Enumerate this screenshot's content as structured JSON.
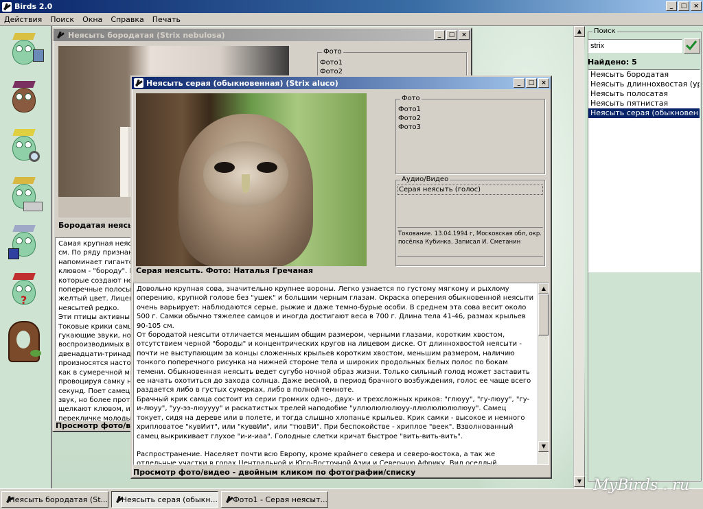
{
  "app": {
    "title": "Birds 2.0",
    "window_buttons": [
      "_",
      "□",
      "×"
    ]
  },
  "menu": [
    "Действия",
    "Поиск",
    "Окна",
    "Справка",
    "Печать"
  ],
  "sidebar_icons": [
    "owl-computer-icon",
    "owl-books-icon",
    "owl-magnifier-icon",
    "owl-printer-icon",
    "owl-diskette-icon",
    "owl-question-icon",
    "owl-tree-icon"
  ],
  "win_back": {
    "title": "Неясыть бородатая (Strix nebulosa)",
    "photo_caption": "Бородатая неясыть",
    "photos_label": "Фото",
    "photos": [
      "Фото1",
      "Фото2"
    ],
    "text_lines": [
      "Самая крупная неясыть",
      "см. По ряду признако",
      "напоминает гигантск",
      "клювом - \"бороду\". В",
      "которые создают не",
      "поперечные полосы.",
      "желтый цвет. Лицево",
      "неясытей редко.",
      "Эти птицы активны в",
      "Токовые крики самца",
      "гукающие звуки, но",
      "воспроизводимых в е",
      "двенадцати-тринадц",
      "произносятся настол",
      "как в сумеречной мгл",
      "провоцируя самку на",
      "секунд. Поет самец в",
      "звук, но более протя",
      "щелкают клювом, из",
      "перекличке молодые"
    ],
    "footer": "Просмотр фото/ви"
  },
  "win_front": {
    "title": "Неясыть серая (обыкновенная) (Strix aluco)",
    "photo_caption": "Серая неясыть. Фото: Наталья Гречаная",
    "photos_label": "Фото",
    "photos": [
      "Фото1",
      "Фото2",
      "Фото3"
    ],
    "av_label": "Аудио/Видео",
    "av_items": [
      "Серая неясыть (голос)"
    ],
    "av_note": "Токование. 13.04.1994 г, Московская обл, окр. посёлка Кубинка. Записал И. Сметанин",
    "text_paragraphs": [
      "Довольно крупная сова, значительно крупнее вороны. Легко узнается по густому мягкому и рыхлому оперению, крупной голове без \"ушек\" и большим черным глазам. Окраска оперения обыкновенной неясыти очень варьирует: наблюдаются серые, рыжие и даже темно-бурые особи. В среднем эта сова весит около 500 г. Самки обычно тяжелее самцов и иногда достигают веса в 700 г. Длина тела 41-46, размах крыльев 90-105 см.",
      "От бородатой неясыти отличается меньшим общим размером, черными глазами, коротким хвостом, отсутствием черной \"бороды\" и концентрических кругов на лицевом диске. От длиннохвостой неясыти - почти не выступающим за концы сложенных крыльев коротким хвостом, меньшим размером, наличию тонкого поперечного рисунка на нижней стороне тела и широких продольных белых полос по бокам темени. Обыкновенная неясыть ведет сугубо ночной образ жизни. Только сильный голод может заставить ее начать охотиться до захода солнца. Даже весной, в период брачного возбуждения, голос ее чаще всего раздается либо в густых сумерках, либо в полной темноте.",
      "Брачный крик самца состоит из серии громких одно-, двух- и трехсложных криков: \"глюуу\", \"гу-люуу\", \"гу-и-люуу\", \"уу-ээ-люуууу\" и раскатистых трелей наподобие \"уллюлюлюлюуу-ллюлюлюлюлюуу\". Самец токует, сидя на дереве или в полете, и тогда слышно хлопанье крыльев. Крик самки - высокое и немного хрипловатое \"кувИит\", или \"куввИи\", или \"тювВИ\". При беспокойстве - хриплое \"веек\". Взволнованный самец выкрикивает глухое \"и-и-иаа\". Голодные слетки кричат быстрое \"вить-вить-вить\".",
      "",
      "Распространение. Населяет почти всю Европу, кроме крайнего севера и северо-востока, а так же отдельные участки в горах Центральной и Юго-Восточной Азии и Северную Африку. Вид оседлый, кочующий зимой. Известны следующие подвиды:"
    ],
    "footer": "Просмотр фото/видео - двойным кликом по фотографии/списку"
  },
  "search": {
    "label": "Поиск",
    "value": "strix",
    "found": "Найдено: 5",
    "results": [
      "Неясыть бородатая",
      "Неясыть длиннохвостая (ур",
      "Неясыть полосатая",
      "Неясыть пятнистая",
      "Неясыть серая (обыкновен"
    ],
    "selected_index": 4
  },
  "taskbar": [
    "Неясыть бородатая (St...",
    "Неясыть серая (обыкн...",
    "Фото1 - Серая неясыт..."
  ],
  "watermark": "MyBirds . ru"
}
